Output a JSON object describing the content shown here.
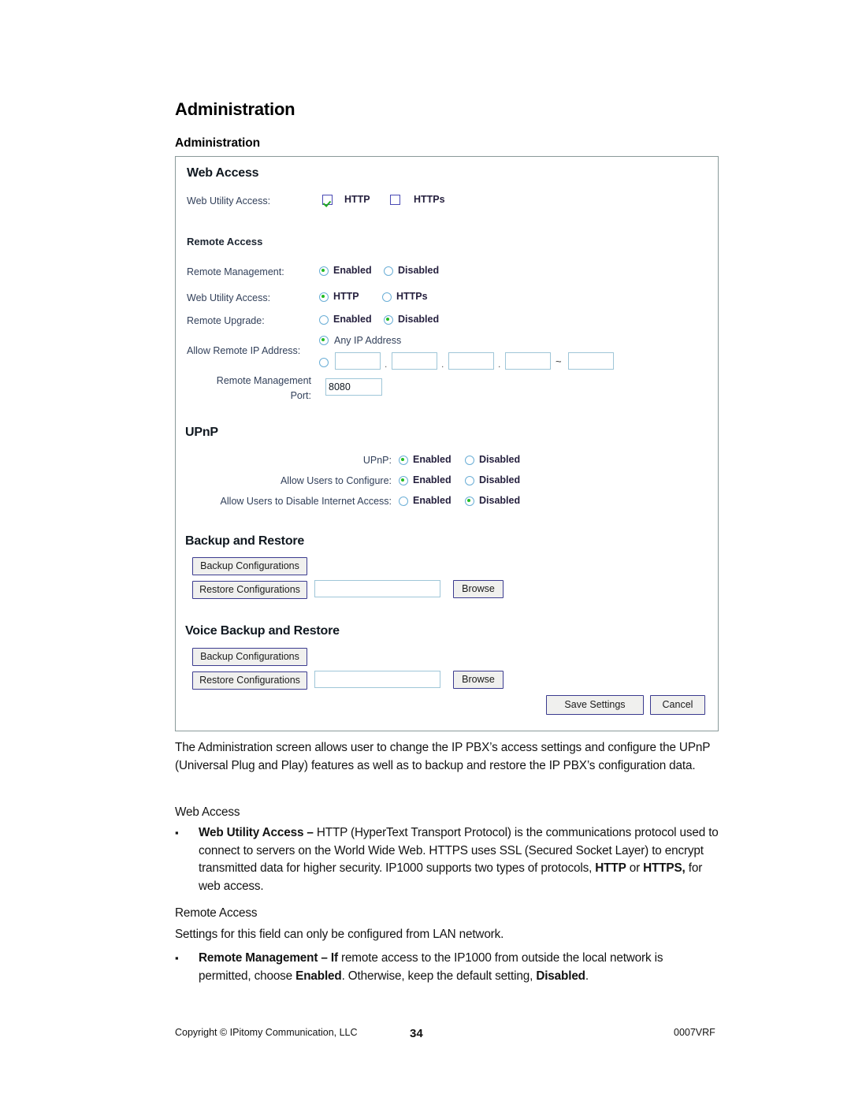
{
  "document": {
    "title": "Administration",
    "section_heading": "Administration"
  },
  "panel": {
    "web_access": {
      "heading": "Web Access",
      "web_utility_access_label": "Web Utility Access:",
      "http_label": "HTTP",
      "http_checked": true,
      "https_label": "HTTPs",
      "https_checked": false
    },
    "remote_access": {
      "heading": "Remote Access",
      "rows": [
        {
          "label": "Remote Management:",
          "options": [
            "Enabled",
            "Disabled"
          ],
          "selected": "Enabled"
        },
        {
          "label": "Web Utility Access:",
          "options": [
            "HTTP",
            "HTTPs"
          ],
          "selected": "HTTP"
        },
        {
          "label": "Remote Upgrade:",
          "options": [
            "Enabled",
            "Disabled"
          ],
          "selected": "Disabled"
        }
      ],
      "allow_remote_ip_label": "Allow Remote IP Address:",
      "any_ip_label": "Any IP Address",
      "any_ip_selected": true,
      "specific_ip_selected": false,
      "octets": [
        "",
        "",
        "",
        ""
      ],
      "octet_separator": ".",
      "range_separator": "~",
      "range_end": "",
      "remote_mgmt_port_label_line1": "Remote Management",
      "remote_mgmt_port_label_line2": "Port:",
      "remote_mgmt_port_value": "8080"
    },
    "upnp": {
      "heading": "UPnP",
      "rows": [
        {
          "label": "UPnP:",
          "options": [
            "Enabled",
            "Disabled"
          ],
          "selected": "Enabled"
        },
        {
          "label": "Allow Users to Configure:",
          "options": [
            "Enabled",
            "Disabled"
          ],
          "selected": "Enabled"
        },
        {
          "label": "Allow Users to Disable Internet Access:",
          "options": [
            "Enabled",
            "Disabled"
          ],
          "selected": "Disabled"
        }
      ]
    },
    "backup_restore": {
      "heading": "Backup and Restore",
      "backup_button": "Backup Configurations",
      "restore_button": "Restore Configurations",
      "restore_file_value": "",
      "browse_button": "Browse"
    },
    "voice_backup_restore": {
      "heading": "Voice Backup and Restore",
      "backup_button": "Backup Configurations",
      "restore_button": "Restore Configurations",
      "restore_file_value": "",
      "browse_button": "Browse"
    },
    "actions": {
      "save_button": "Save Settings",
      "cancel_button": "Cancel"
    }
  },
  "body": {
    "intro": "The Administration screen allows user to change the IP PBX’s access settings and configure the UPnP (Universal Plug and Play) features as well as to backup and restore the IP PBX’s configuration data.",
    "web_access_heading": "Web Access",
    "bullet_mark": "▪",
    "web_utility_bullet": {
      "term": "Web Utility Access –",
      "text_1": " HTTP (HyperText Transport Protocol) is the communications protocol used to connect to servers on the World Wide Web. HTTPS uses SSL (Secured Socket Layer) to encrypt transmitted data for higher security. IP1000 supports two types of protocols, ",
      "strong_1": "HTTP",
      "text_2": " or ",
      "strong_2": "HTTPS,",
      "text_3": " for web access."
    },
    "remote_access_heading": "Remote Access",
    "remote_access_note": "Settings for this field can only be configured from LAN network.",
    "remote_management_bullet": {
      "term": "Remote Management – If",
      "text_1": " remote access to the IP1000 from outside the local network is permitted, choose ",
      "strong_1": "Enabled",
      "text_2": ". Otherwise, keep the default setting, ",
      "strong_2": "Disabled",
      "text_3": "."
    }
  },
  "footer": {
    "copyright": "Copyright © IPitomy Communication, LLC",
    "page_number": "34",
    "doc_code": "0007VRF"
  }
}
